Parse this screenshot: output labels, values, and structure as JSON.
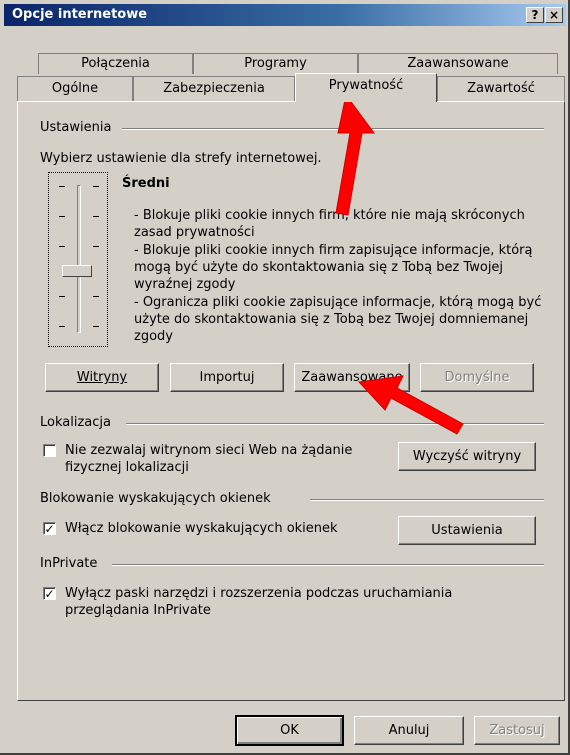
{
  "window": {
    "title": "Opcje internetowe",
    "help_label": "?",
    "close_label": "×"
  },
  "tabs_row1": [
    "Połączenia",
    "Programy",
    "Zaawansowane"
  ],
  "tabs_row2": [
    "Ogólne",
    "Zabezpieczenia",
    "Prywatność",
    "Zawartość"
  ],
  "settings": {
    "group_label": "Ustawienia",
    "prompt": "Wybierz ustawienie dla strefy internetowej.",
    "level": "Średni",
    "desc1": "- Blokuje pliki cookie innych firm, które nie mają skróconych zasad prywatności",
    "desc2": "- Blokuje pliki cookie innych firm zapisujące informacje, którą mogą być użyte do skontaktowania się z Tobą bez Twojej wyraźnej zgody",
    "desc3": "- Ogranicza pliki cookie zapisujące informacje, którą mogą być użyte do skontaktowania się z Tobą bez Twojej domniemanej zgody",
    "slider_value": "3/6",
    "btn_sites": "Witryny",
    "btn_import": "Importuj",
    "btn_advanced": "Zaawansowane",
    "btn_default": "Domyślne"
  },
  "location": {
    "group_label": "Lokalizacja",
    "checkbox_label": "Nie zezwalaj witrynom sieci Web na żądanie fizycznej lokalizacji",
    "checked": false,
    "clear_button": "Wyczyść witryny"
  },
  "popup": {
    "group_label": "Blokowanie wyskakujących okienek",
    "checkbox_label": "Włącz blokowanie wyskakujących okienek",
    "checked": true,
    "settings_button": "Ustawienia"
  },
  "inprivate": {
    "group_label": "InPrivate",
    "checkbox_label": "Wyłącz paski narzędzi i rozszerzenia podczas uruchamiania przeglądania InPrivate",
    "checked": true
  },
  "footer": {
    "ok": "OK",
    "cancel": "Anuluj",
    "apply": "Zastosuj"
  },
  "colors": {
    "titlebar": "#0a246a",
    "annotation_arrow": "#ff0000",
    "face": "#d4d0c8"
  }
}
